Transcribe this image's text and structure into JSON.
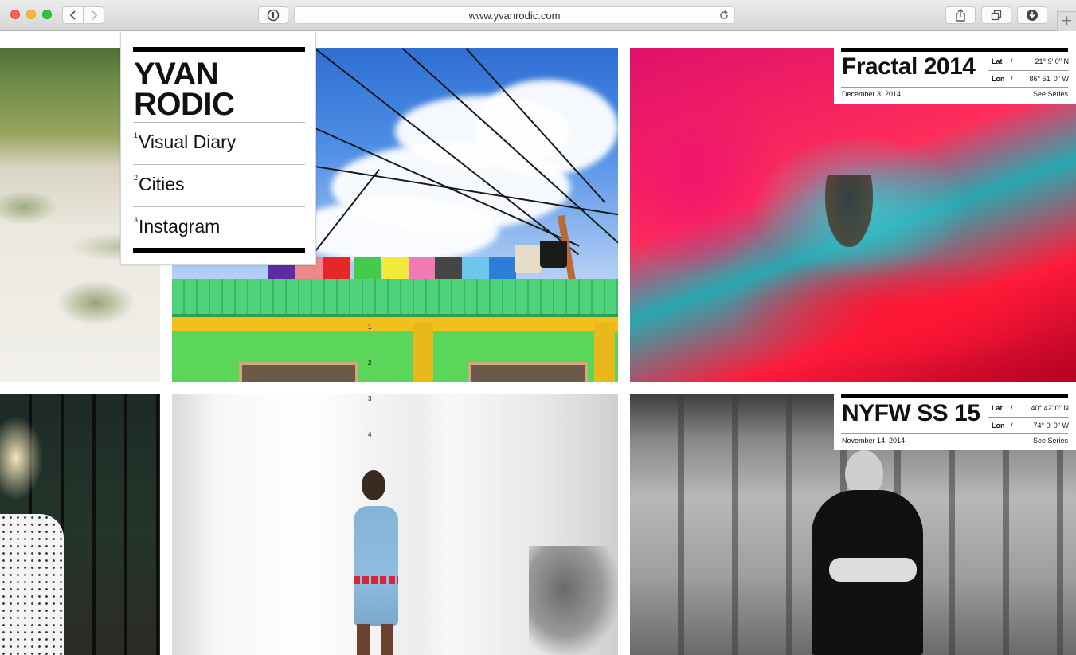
{
  "browser": {
    "url": "www.yvanrodic.com",
    "icons": {
      "back": "chevron-left-icon",
      "forward": "chevron-right-icon",
      "reader": "info-icon",
      "reload": "reload-icon",
      "share": "share-icon",
      "tabs": "tabs-icon",
      "downloads": "download-icon",
      "new_tab": "plus-icon"
    },
    "new_tab_label": "+"
  },
  "menu": {
    "logo_line1": "YVAN",
    "logo_line2": "RODIC",
    "items": [
      {
        "num": "1",
        "label": "Visual Diary"
      },
      {
        "num": "2",
        "label": "Cities"
      },
      {
        "num": "3",
        "label": "Instagram"
      }
    ]
  },
  "side_numbers": [
    "1",
    "2",
    "3",
    "4"
  ],
  "series": [
    {
      "title": "Fractal 2014",
      "lat_label": "Lat",
      "lat_value": "21° 9' 0\" N",
      "lon_label": "Lon",
      "lon_value": "86° 51' 0\" W",
      "separator": "/",
      "date": "December 3. 2014",
      "link": "See Series"
    },
    {
      "title": "NYFW SS 15",
      "lat_label": "Lat",
      "lat_value": "40° 42' 0\" N",
      "lon_label": "Lon",
      "lon_value": "74° 0' 0\" W",
      "separator": "/",
      "date": "November 14. 2014",
      "link": "See Series"
    }
  ],
  "colors": {
    "accent": "#000000",
    "close": "#fc5f57",
    "minimize": "#fdbc2e",
    "zoom": "#28c840"
  }
}
